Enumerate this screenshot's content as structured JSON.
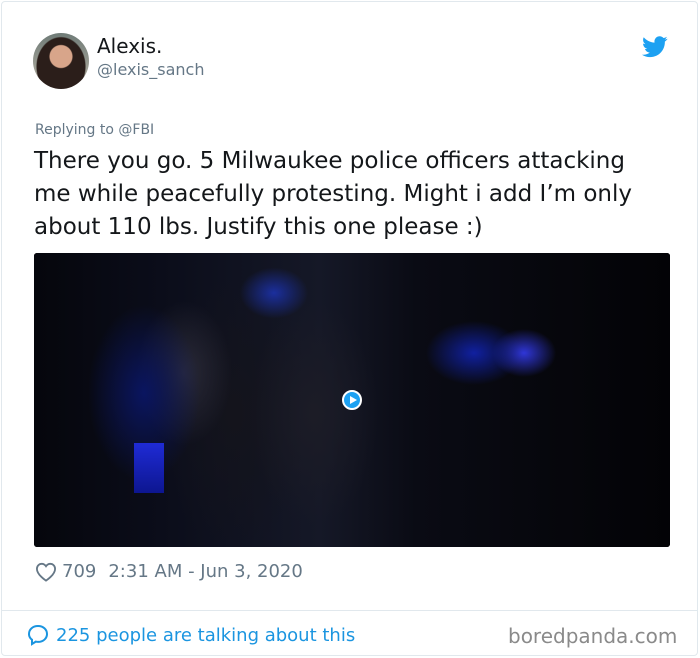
{
  "user": {
    "display_name": "Alexis.",
    "handle": "@lexis_sanch"
  },
  "reply": {
    "prefix": "Replying to",
    "mention": "@FBI"
  },
  "tweet": {
    "text": "There you go. 5 Milwaukee police officers attacking\nme while peacefully protesting. Might i add I’m only\nabout 110 lbs. Justify this one please :)"
  },
  "stats": {
    "likes": "709",
    "timestamp": "2:31 AM - Jun 3, 2020"
  },
  "footer": {
    "talking": "225 people are talking about this",
    "watermark": "boredpanda.com"
  },
  "colors": {
    "twitter_blue": "#1da1f2",
    "link_blue": "#1b95e0",
    "secondary_text": "#657786"
  },
  "icons": [
    "twitter-bird-icon",
    "heart-icon",
    "speech-bubble-icon",
    "play-icon"
  ]
}
